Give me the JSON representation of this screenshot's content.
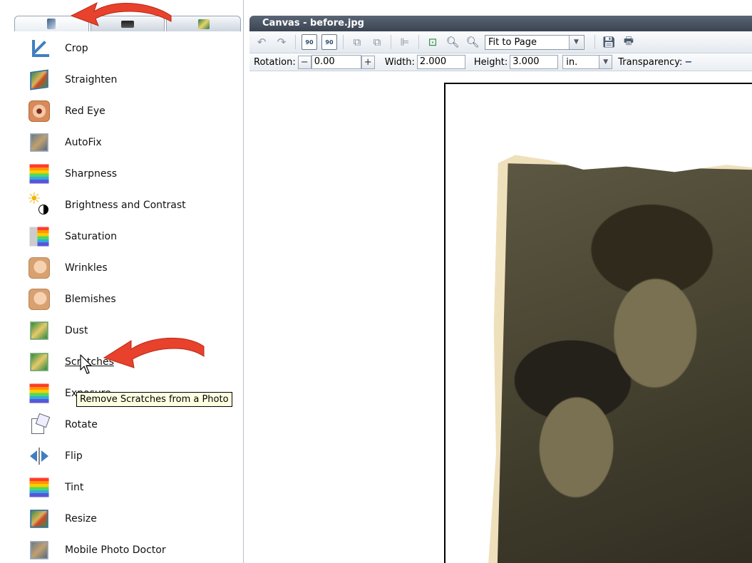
{
  "left_panel": {
    "tabs": [
      {
        "name": "adjust",
        "icon": "adjust-tools-icon"
      },
      {
        "name": "frames",
        "icon": "frames-icon"
      },
      {
        "name": "effects",
        "icon": "effects-icon"
      }
    ],
    "tools": [
      {
        "label": "Crop",
        "icon": "crop-icon"
      },
      {
        "label": "Straighten",
        "icon": "straighten-icon"
      },
      {
        "label": "Red Eye",
        "icon": "red-eye-icon"
      },
      {
        "label": "AutoFix",
        "icon": "autofix-icon"
      },
      {
        "label": "Sharpness",
        "icon": "sharpness-icon"
      },
      {
        "label": "Brightness and Contrast",
        "icon": "brightness-icon"
      },
      {
        "label": "Saturation",
        "icon": "saturation-icon"
      },
      {
        "label": "Wrinkles",
        "icon": "wrinkles-icon"
      },
      {
        "label": "Blemishes",
        "icon": "blemishes-icon"
      },
      {
        "label": "Dust",
        "icon": "dust-icon"
      },
      {
        "label": "Scratches",
        "icon": "scratches-icon"
      },
      {
        "label": "Exposure",
        "icon": "exposure-icon"
      },
      {
        "label": "Rotate",
        "icon": "rotate-icon"
      },
      {
        "label": "Flip",
        "icon": "flip-icon"
      },
      {
        "label": "Tint",
        "icon": "tint-icon"
      },
      {
        "label": "Resize",
        "icon": "resize-icon"
      },
      {
        "label": "Mobile Photo Doctor",
        "icon": "mobile-photo-doctor-icon"
      }
    ],
    "tooltip": "Remove Scratches from a Photo"
  },
  "canvas": {
    "title": "Canvas - before.jpg",
    "toolbar": {
      "rotate_left_label": "90",
      "rotate_right_label": "90",
      "zoom_value": "Fit to Page"
    },
    "properties": {
      "rotation_label": "Rotation:",
      "rotation_value": "0.00",
      "width_label": "Width:",
      "width_value": "2.000",
      "height_label": "Height:",
      "height_value": "3.000",
      "unit_value": "in.",
      "transparency_label": "Transparency:"
    }
  },
  "colors": {
    "annotation_arrow": "#e8412c",
    "titlebar": "#3f4957",
    "photo_paper": "#efe0bc"
  }
}
